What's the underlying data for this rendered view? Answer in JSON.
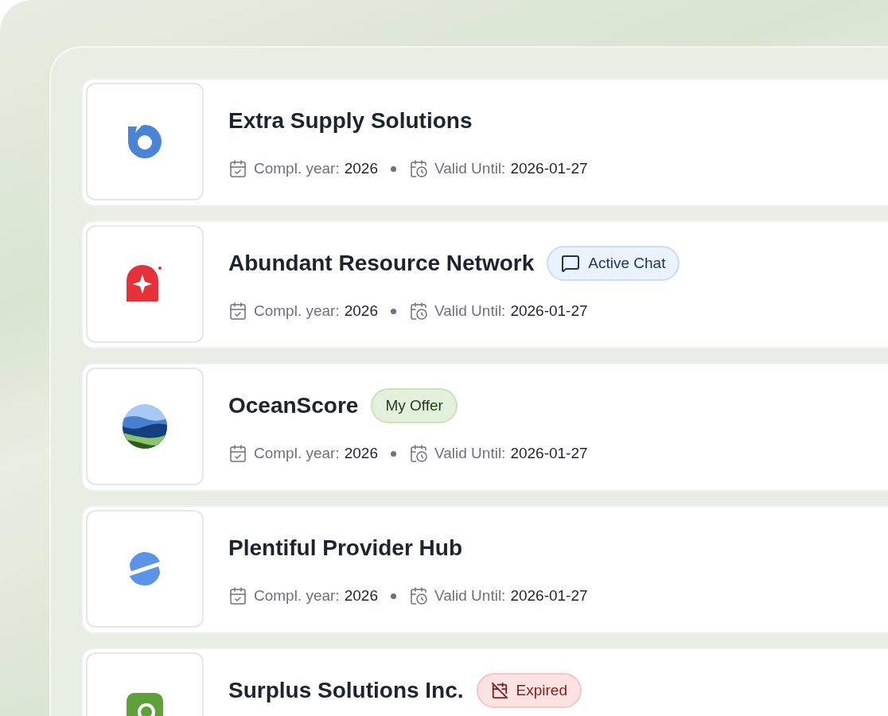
{
  "offers": [
    {
      "name": "Extra Supply Solutions",
      "meta": [
        {
          "label": "Compl. year:",
          "value": "2026"
        },
        {
          "label": "Valid Until:",
          "value": "2026-01-27"
        }
      ]
    },
    {
      "name": "Abundant Resource Network",
      "badge": {
        "kind": "chat",
        "text": "Active Chat"
      },
      "meta": [
        {
          "label": "Compl. year:",
          "value": "2026"
        },
        {
          "label": "Valid Until:",
          "value": "2026-01-27"
        }
      ]
    },
    {
      "name": "OceanScore",
      "badge": {
        "kind": "offer",
        "text": "My Offer"
      },
      "meta": [
        {
          "label": "Compl. year:",
          "value": "2026"
        },
        {
          "label": "Valid Until:",
          "value": "2026-01-27"
        }
      ]
    },
    {
      "name": "Plentiful Provider Hub",
      "meta": [
        {
          "label": "Compl. year:",
          "value": "2026"
        },
        {
          "label": "Valid Until:",
          "value": "2026-01-27"
        }
      ]
    },
    {
      "name": "Surplus Solutions Inc.",
      "badge": {
        "kind": "expired",
        "text": "Expired"
      }
    }
  ]
}
